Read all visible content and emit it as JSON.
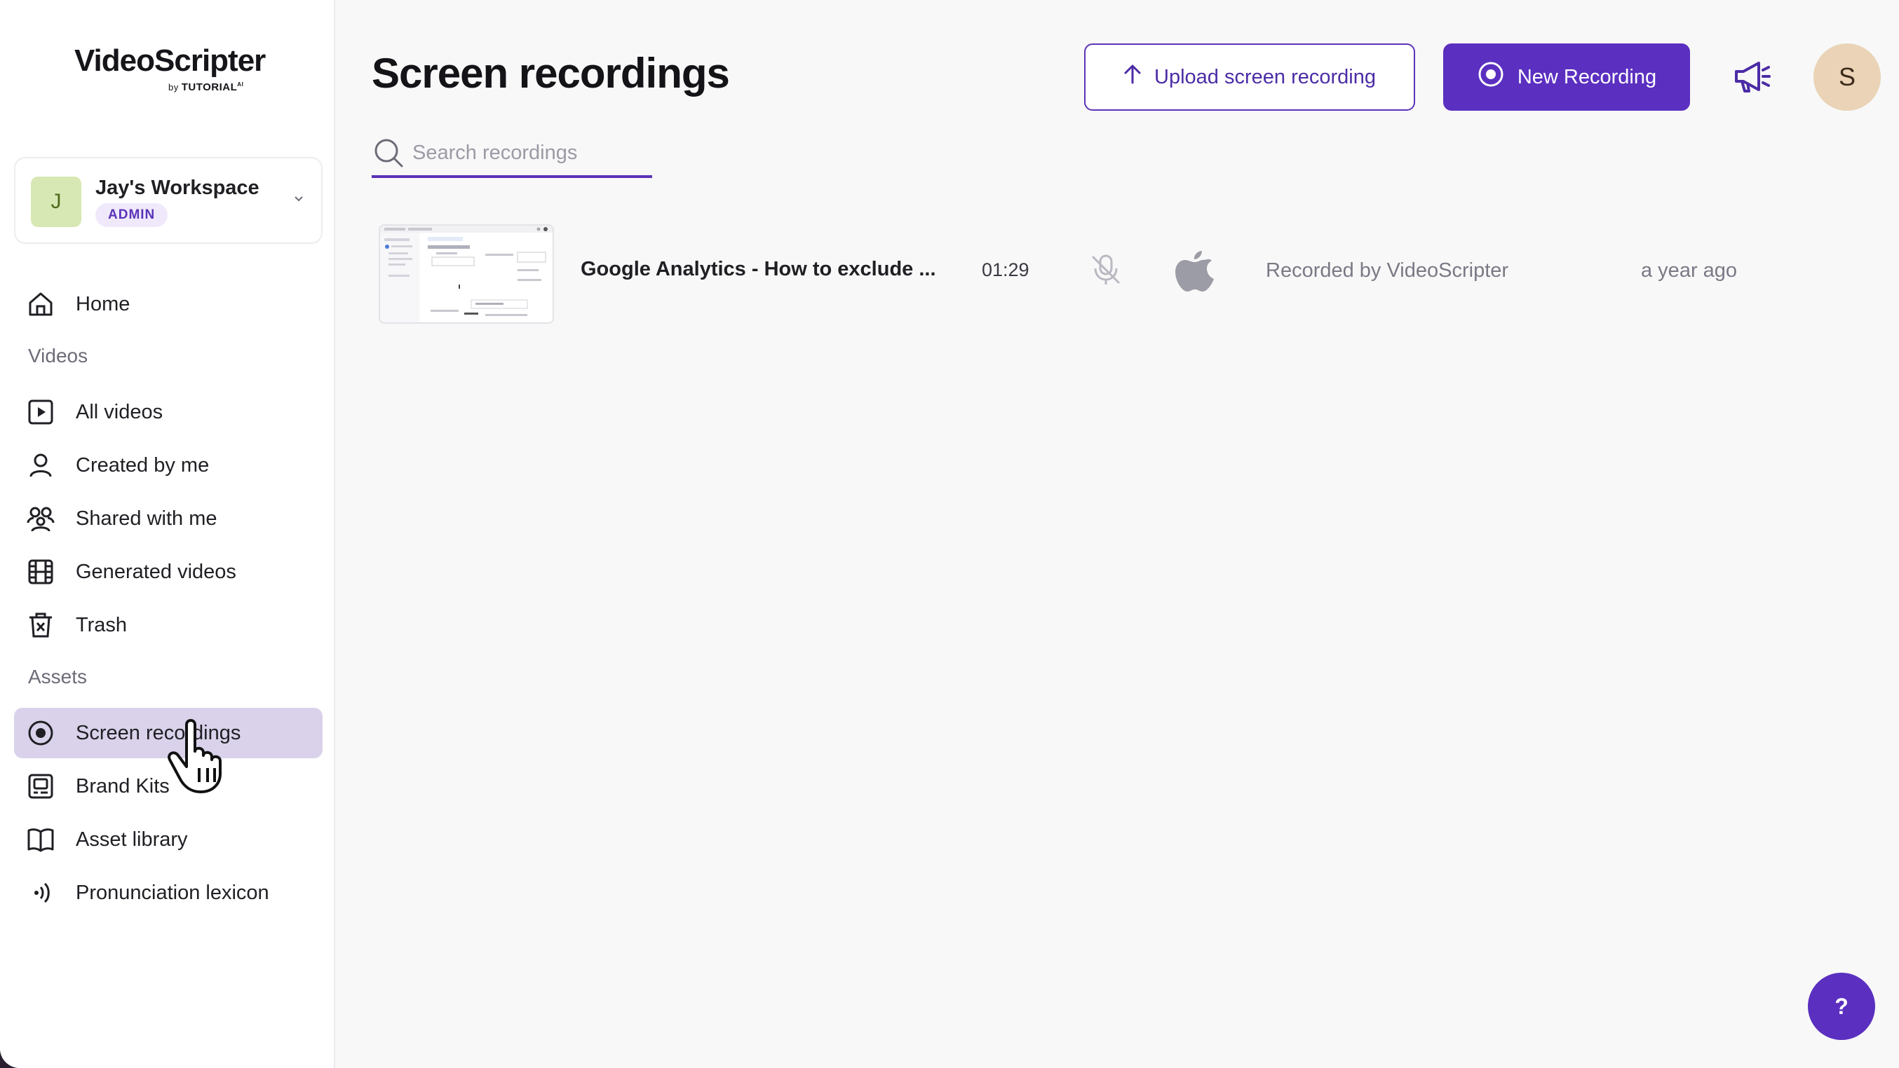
{
  "brand": {
    "name": "VideoScripter",
    "by": "by",
    "company": "TUTORIAL",
    "company_suffix": "AI"
  },
  "workspace": {
    "initial": "J",
    "name": "Jay's Workspace",
    "role": "ADMIN"
  },
  "sidebar": {
    "home": "Home",
    "videos_section": "Videos",
    "videos": [
      "All videos",
      "Created by me",
      "Shared with me",
      "Generated videos",
      "Trash"
    ],
    "assets_section": "Assets",
    "assets": [
      "Screen recordings",
      "Brand Kits",
      "Asset library",
      "Pronunciation lexicon"
    ],
    "active": "Screen recordings"
  },
  "header": {
    "title": "Screen recordings",
    "upload_label": "Upload screen recording",
    "new_recording_label": "New Recording",
    "user_initial": "S"
  },
  "search": {
    "placeholder": "Search recordings",
    "value": ""
  },
  "recordings": [
    {
      "title": "Google Analytics - How to exclude ...",
      "duration": "01:29",
      "audio": "muted",
      "platform": "apple-icon",
      "source": "Recorded by VideoScripter",
      "time": "a year ago"
    }
  ],
  "help_label": "?",
  "colors": {
    "accent": "#5b2fc0",
    "active_nav": "#d9d2ea",
    "badge_bg": "#efe9fb"
  }
}
